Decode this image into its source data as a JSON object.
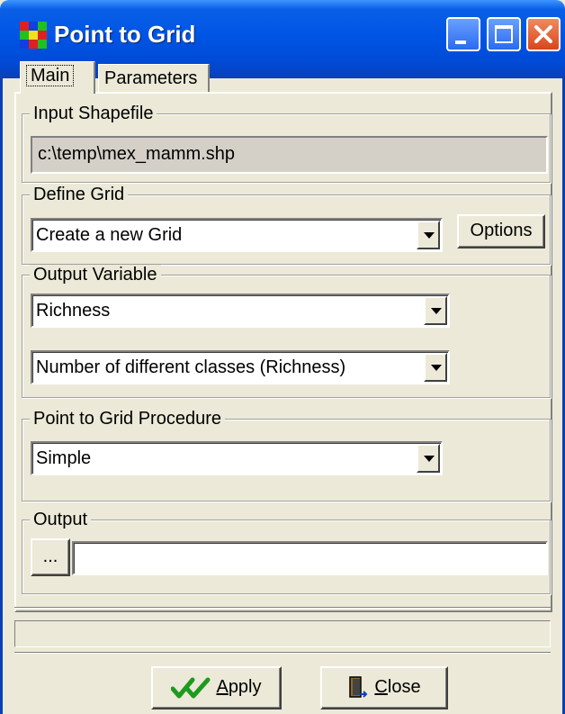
{
  "window": {
    "title": "Point to Grid",
    "icon": "grid-app-icon",
    "controls": [
      "minimize-icon",
      "maximize-icon",
      "close-icon"
    ]
  },
  "tabs": [
    {
      "label": "Main",
      "active": true
    },
    {
      "label": "Parameters",
      "active": false
    }
  ],
  "input_shapefile": {
    "legend": "Input Shapefile",
    "value": "c:\\temp\\mex_mamm.shp"
  },
  "define_grid": {
    "legend": "Define Grid",
    "selected": "Create a new Grid",
    "options_button": "Options"
  },
  "output_variable": {
    "legend": "Output Variable",
    "variable": "Richness",
    "method": "Number of different classes (Richness)"
  },
  "procedure": {
    "legend": "Point to Grid Procedure",
    "selected": "Simple"
  },
  "output": {
    "legend": "Output",
    "browse_label": "...",
    "value": ""
  },
  "buttons": {
    "apply_rest": "pply",
    "apply_mnemonic": "A",
    "close_rest": "lose",
    "close_mnemonic": "C"
  },
  "colors": {
    "titlebar": "#0055e5",
    "face": "#ece9d8",
    "apply_check": "#1e9a1e"
  }
}
